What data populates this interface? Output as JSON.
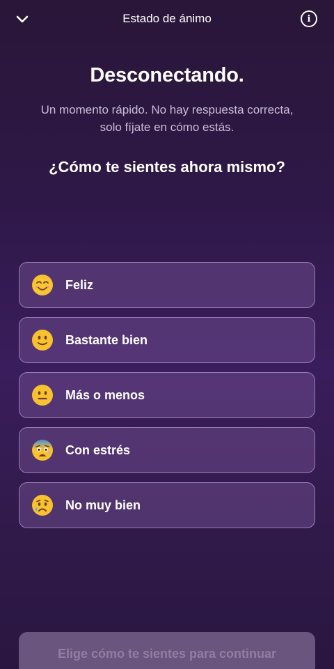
{
  "header": {
    "title": "Estado de ánimo",
    "back_icon": "chevron-down-icon",
    "info_icon": "info-icon"
  },
  "main": {
    "heading": "Desconectando.",
    "subtitle_line1": "Un momento rápido. No hay respuesta correcta,",
    "subtitle_line2": "solo fíjate en cómo estás.",
    "question": "¿Cómo te sientes ahora mismo?"
  },
  "options": [
    {
      "label": "Feliz",
      "icon": "smiling-face-icon"
    },
    {
      "label": "Bastante bien",
      "icon": "slightly-smiling-face-icon"
    },
    {
      "label": "Más o menos",
      "icon": "neutral-face-icon"
    },
    {
      "label": "Con estrés",
      "icon": "anxious-face-icon"
    },
    {
      "label": "No muy bien",
      "icon": "crying-face-icon"
    }
  ],
  "footer": {
    "continue_label": "Elige cómo te sientes para continuar"
  },
  "colors": {
    "background": "#2e1848",
    "option_fill": "#4e3568",
    "option_border": "#a98cc4",
    "cta_disabled": "#6a557e",
    "emoji_yellow": "#f7c12f"
  }
}
